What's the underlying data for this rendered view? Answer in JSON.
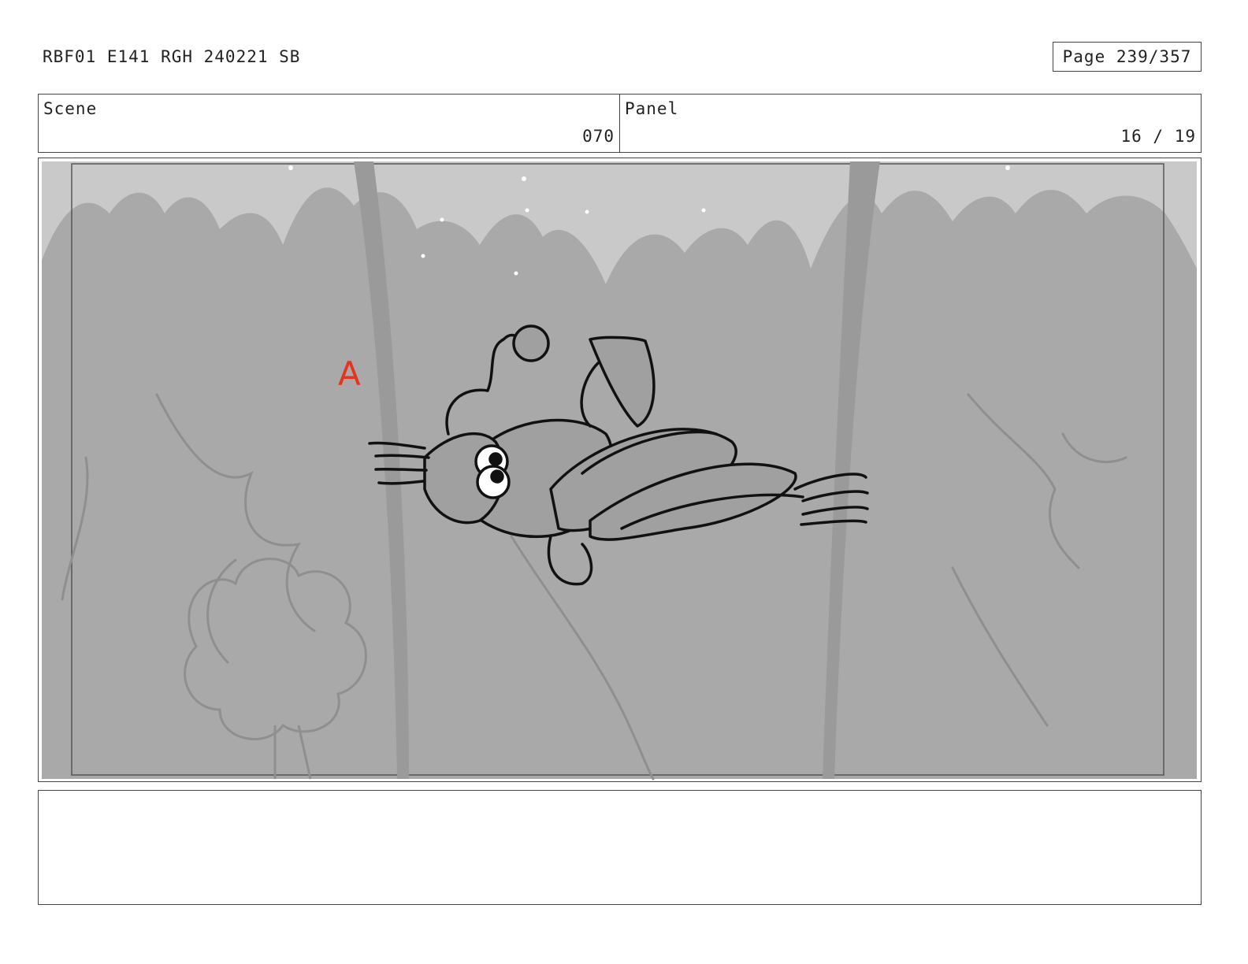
{
  "header": {
    "doc_title": "RBF01 E141 RGH 240221 SB",
    "page": "Page 239/357"
  },
  "info": {
    "scene_label": "Scene",
    "scene_value": "070",
    "panel_label": "Panel",
    "panel_value": "16 / 19"
  },
  "frame": {
    "annotation_mark": "A",
    "annotation_color": "#e8331c",
    "sky_color": "#c8c8c8",
    "forest_color": "#a8a8a8"
  },
  "notes": {
    "text": ""
  }
}
